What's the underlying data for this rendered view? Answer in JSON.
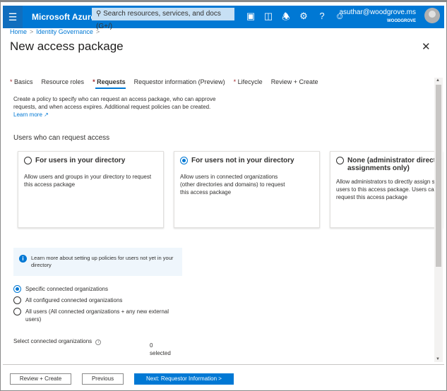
{
  "topbar": {
    "brand": "Microsoft Azure",
    "search_placeholder": "Search resources, services, and docs (G+/)",
    "user_email": "asuthar@woodgrove.ms",
    "user_org": "WOODGROVE",
    "icons": [
      "cloud-shell-icon",
      "directory-filter-icon",
      "bell-icon",
      "gear-icon",
      "help-icon",
      "feedback-smiley-icon"
    ]
  },
  "breadcrumb": [
    "Home",
    "Identity Governance"
  ],
  "page": {
    "title": "New access package"
  },
  "tabs": [
    {
      "label": "Basics",
      "required": true
    },
    {
      "label": "Resource roles",
      "required": false
    },
    {
      "label": "Requests",
      "required": true,
      "active": true
    },
    {
      "label": "Requestor information (Preview)",
      "required": false
    },
    {
      "label": "Lifecycle",
      "required": true
    },
    {
      "label": "Review + Create",
      "required": false
    }
  ],
  "description": "Create a policy to specify who can request an access package, who can approve requests, and when access expires. Additional request policies can be created.",
  "learn_more": "Learn more",
  "section_heading": "Users who can request access",
  "cards": [
    {
      "title": "For users in your directory",
      "body": "Allow users and groups in your directory to request this access package",
      "selected": false
    },
    {
      "title": "For users not in your directory",
      "body": "Allow users in connected organizations (other directories and domains) to request this access package",
      "selected": true
    },
    {
      "title": "None (administrator direct assignments only)",
      "body": "Allow administrators to directly assign specific users to this access package. Users cannot request this access package",
      "selected": false
    }
  ],
  "info_text": "Learn more about setting up policies for users not yet in your directory",
  "options": [
    {
      "label": "Specific connected organizations",
      "selected": true
    },
    {
      "label": "All configured connected organizations",
      "selected": false
    },
    {
      "label": "All users (All connected organizations + any new external users)",
      "selected": false
    }
  ],
  "select_orgs": {
    "label": "Select connected organizations",
    "count": "0",
    "count_suffix": "selected"
  },
  "footer": {
    "review": "Review + Create",
    "previous": "Previous",
    "next": "Next: Requestor Information >"
  },
  "colors": {
    "accent": "#0078d4",
    "required": "#a4262c"
  }
}
